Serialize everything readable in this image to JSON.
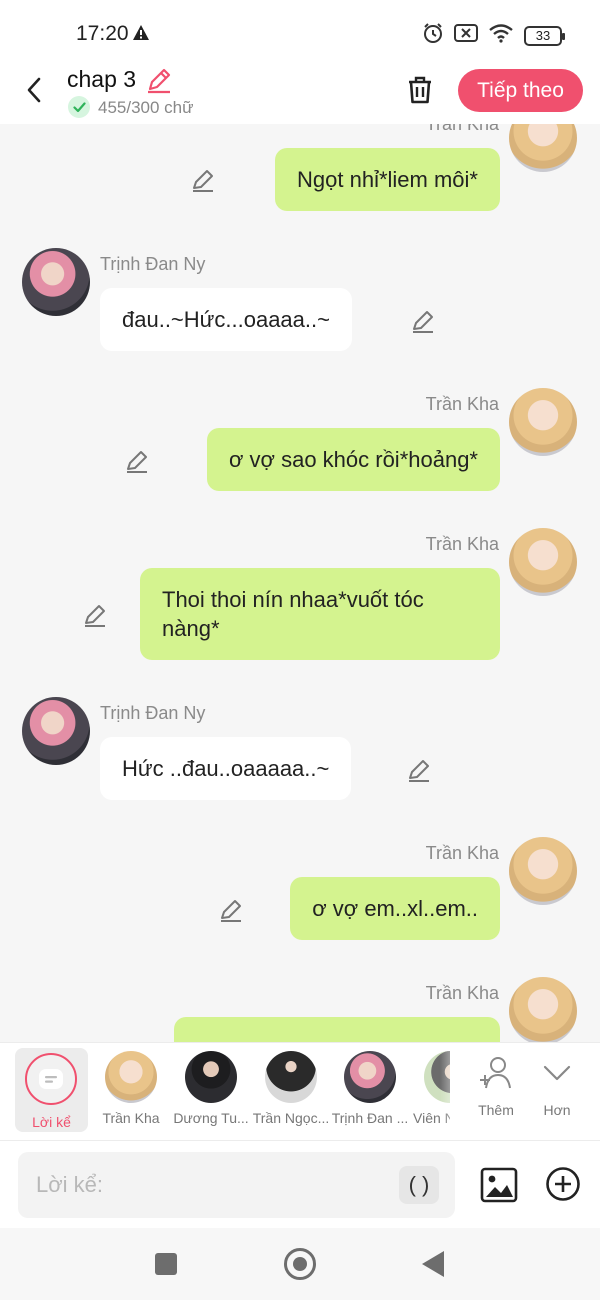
{
  "status_bar": {
    "time": "17:20",
    "battery": "33"
  },
  "header": {
    "title": "chap 3",
    "word_count": "455/300 chữ",
    "next_label": "Tiếp theo",
    "accent_color": "#f0506e"
  },
  "messages": [
    {
      "sender": "Trần Kha",
      "side": "right",
      "text": "Ngọt nhỉ*liem môi*"
    },
    {
      "sender": "Trịnh Đan Ny",
      "side": "left",
      "text": "đau..~Hức...oaaaa..~"
    },
    {
      "sender": "Trần Kha",
      "side": "right",
      "text": "ơ vợ sao khóc rồi*hoảng*"
    },
    {
      "sender": "Trần Kha",
      "side": "right",
      "text": "Thoi thoi nín nhaa*vuốt tóc nàng*"
    },
    {
      "sender": "Trịnh Đan Ny",
      "side": "left",
      "text": "Hức ..đau..oaaaaa..~"
    },
    {
      "sender": "Trần Kha",
      "side": "right",
      "text": "ơ vợ em..xl..em.."
    },
    {
      "sender": "Trần Kha",
      "side": "right",
      "text": ""
    }
  ],
  "characters": {
    "narration_label": "Lời kể",
    "items": [
      {
        "name": "Trần Kha"
      },
      {
        "name": "Dương Tu..."
      },
      {
        "name": "Trần Ngọc..."
      },
      {
        "name": "Trịnh Đan ..."
      },
      {
        "name": "Viên N"
      }
    ],
    "add_label": "Thêm",
    "more_label": "Hơn"
  },
  "composer": {
    "placeholder": "Lời kể:",
    "paren_label": "( )"
  },
  "colors": {
    "right_bubble": "#d4f38f",
    "left_bubble": "#ffffff",
    "chat_background": "#f6f6f6"
  }
}
